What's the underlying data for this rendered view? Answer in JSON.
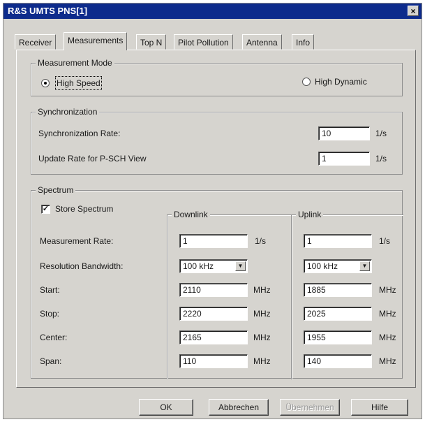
{
  "window": {
    "title": "R&S UMTS PNS[1]",
    "close_glyph": "×"
  },
  "tabs": [
    "Receiver",
    "Measurements",
    "Top N",
    "Pilot Pollution",
    "Antenna",
    "Info"
  ],
  "measurement_mode": {
    "legend": "Measurement Mode",
    "high_speed": "High Speed",
    "high_dynamic": "High Dynamic",
    "selected": "High Speed"
  },
  "synchronization": {
    "legend": "Synchronization",
    "rate_label": "Synchronization Rate:",
    "rate_value": "10",
    "rate_unit": "1/s",
    "update_label": "Update Rate for P-SCH View",
    "update_value": "1",
    "update_unit": "1/s"
  },
  "spectrum": {
    "legend": "Spectrum",
    "store_label": "Store Spectrum",
    "store_checked": true,
    "check_glyph": "✓",
    "downlink_legend": "Downlink",
    "uplink_legend": "Uplink",
    "rows": {
      "meas_rate": {
        "label": "Measurement Rate:",
        "downlink": "1",
        "uplink": "1",
        "unit": "1/s"
      },
      "rbw": {
        "label": "Resolution Bandwidth:",
        "downlink": "100 kHz",
        "uplink": "100 kHz"
      },
      "start": {
        "label": "Start:",
        "downlink": "2110",
        "uplink": "1885",
        "unit": "MHz"
      },
      "stop": {
        "label": "Stop:",
        "downlink": "2220",
        "uplink": "2025",
        "unit": "MHz"
      },
      "center": {
        "label": "Center:",
        "downlink": "2165",
        "uplink": "1955",
        "unit": "MHz"
      },
      "span": {
        "label": "Span:",
        "downlink": "110",
        "uplink": "140",
        "unit": "MHz"
      }
    },
    "dropdown_glyph": "▼"
  },
  "buttons": {
    "ok": "OK",
    "cancel": "Abbrechen",
    "apply": "Übernehmen",
    "help": "Hilfe"
  }
}
